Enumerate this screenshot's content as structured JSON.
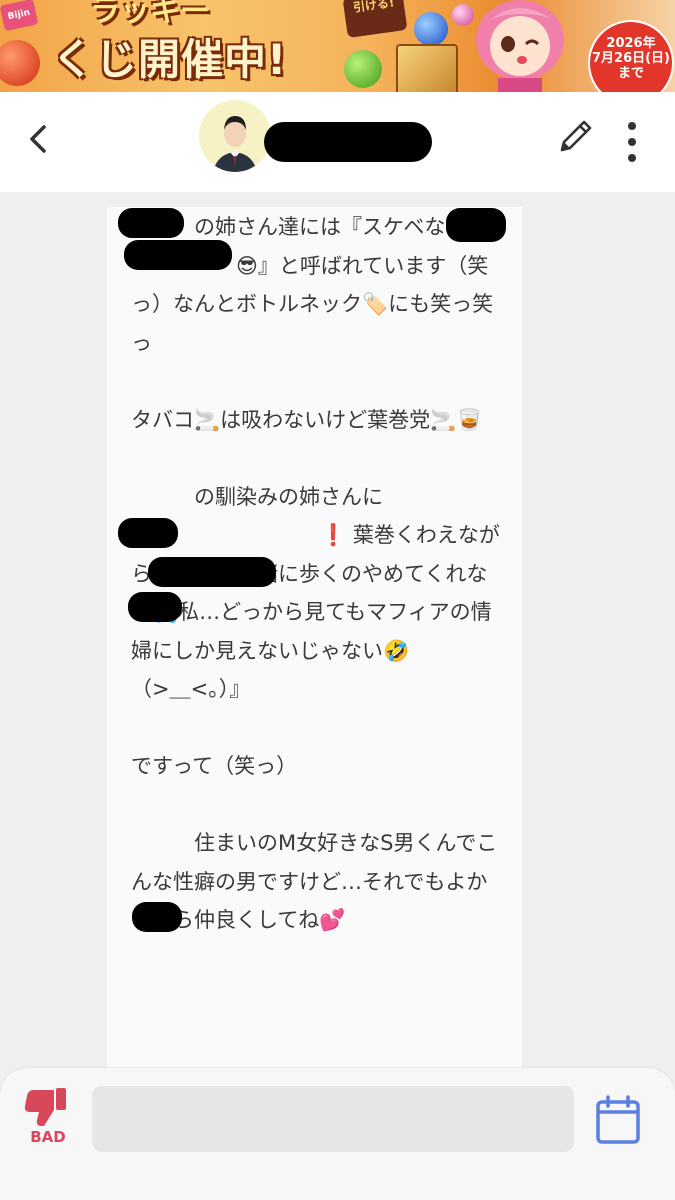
{
  "banner": {
    "headline": "くじ開催中!",
    "top_text": "ラッキー",
    "sticker": "引ける!",
    "logo": "Bijin",
    "badge_year": "2026年",
    "badge_date": "7月26日(日)",
    "badge_suffix": "まで"
  },
  "header": {
    "contact_name": ""
  },
  "message": {
    "text": "　　　の姉さん達には『スケベな\n　　　　　😎』と呼ばれています（笑っ）なんとボトルネック🏷️にも笑っ笑っ\n\nタバコ🚬は吸わないけど葉巻党🚬🥃\n\n　　　の馴染みの姉さんに\n「　　　　　　　　❗ 葉巻くわえながら　　私と一緒に歩くのやめてくれない💦私…どっから見てもマフィアの情婦にしか見えないじゃない🤣\n（>＿<。）』\n\nですって（笑っ）\n\n　　　住まいのM女好きなS男くんでこんな性癖の男ですけど…それでもよかったら仲良くしてね💕"
  },
  "bottom": {
    "bad_label": "BAD",
    "input_value": "",
    "input_placeholder": ""
  },
  "colors": {
    "bad_red": "#d9485a",
    "calendar_blue": "#5b7fe0",
    "header_bg": "#ffffff",
    "page_bg": "#efefef"
  },
  "icons": [
    "back-icon",
    "avatar",
    "edit-icon",
    "menu-icon",
    "thumbs-down-icon",
    "calendar-icon"
  ]
}
